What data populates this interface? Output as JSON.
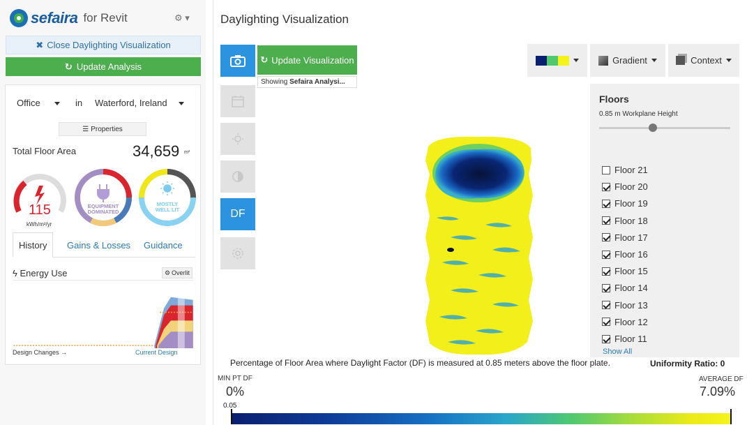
{
  "app": {
    "brand": "sefaira",
    "for_label": "for Revit"
  },
  "left": {
    "close_label": "Close Daylighting Visualization",
    "update_label": "Update Analysis",
    "building_type": "Office",
    "in_label": "in",
    "location": "Waterford, Ireland",
    "properties_label": "Properties",
    "total_floor_area_label": "Total Floor Area",
    "total_floor_area_value": "34,659",
    "total_floor_area_unit": "m²",
    "energy_value": "115",
    "energy_unit": "kWh/m²/yr",
    "equipment_badge": "EQUIPMENT DOMINATED",
    "daylight_badge": "MOSTLY WELL LIT",
    "tabs": [
      {
        "label": "History"
      },
      {
        "label": "Gains & Losses"
      },
      {
        "label": "Guidance"
      }
    ],
    "energy_use_label": "Energy Use",
    "overlay_label": "Overlit",
    "design_changes_label": "Design Changes →",
    "current_design_label": "Current Design"
  },
  "main": {
    "title": "Daylighting Visualization",
    "update_viz_label": "Update Visualization",
    "showing_prefix": "Showing",
    "showing_bold": "Sefaira Analysi...",
    "df_label": "DF",
    "gradient_label": "Gradient",
    "context_label": "Context",
    "caption": "Percentage of Floor Area where Daylight Factor (DF) is measured at 0.85 meters above the floor plate.",
    "uniformity": "Uniformity Ratio: 0",
    "min_label": "MIN PT DF",
    "min_value": "0%",
    "avg_label": "AVERAGE DF",
    "avg_value": "7.09%",
    "scale_tick": "0.05"
  },
  "floors": {
    "title": "Floors",
    "workplane": "0.85 m Workplane Height",
    "items": [
      {
        "label": "Floor 21",
        "checked": false
      },
      {
        "label": "Floor 20",
        "checked": true
      },
      {
        "label": "Floor 19",
        "checked": true
      },
      {
        "label": "Floor 18",
        "checked": true
      },
      {
        "label": "Floor 17",
        "checked": true
      },
      {
        "label": "Floor 16",
        "checked": true
      },
      {
        "label": "Floor 15",
        "checked": true
      },
      {
        "label": "Floor 14",
        "checked": true
      },
      {
        "label": "Floor 13",
        "checked": true
      },
      {
        "label": "Floor 12",
        "checked": true
      },
      {
        "label": "Floor 11",
        "checked": true
      }
    ],
    "show_all": "Show All"
  },
  "colors": {
    "green": "#4cae4c",
    "blue": "#2b93e0",
    "link": "#2a7bbf",
    "daylight_yellow": "#f2ef1a",
    "deep_blue": "#0a1f6e"
  }
}
